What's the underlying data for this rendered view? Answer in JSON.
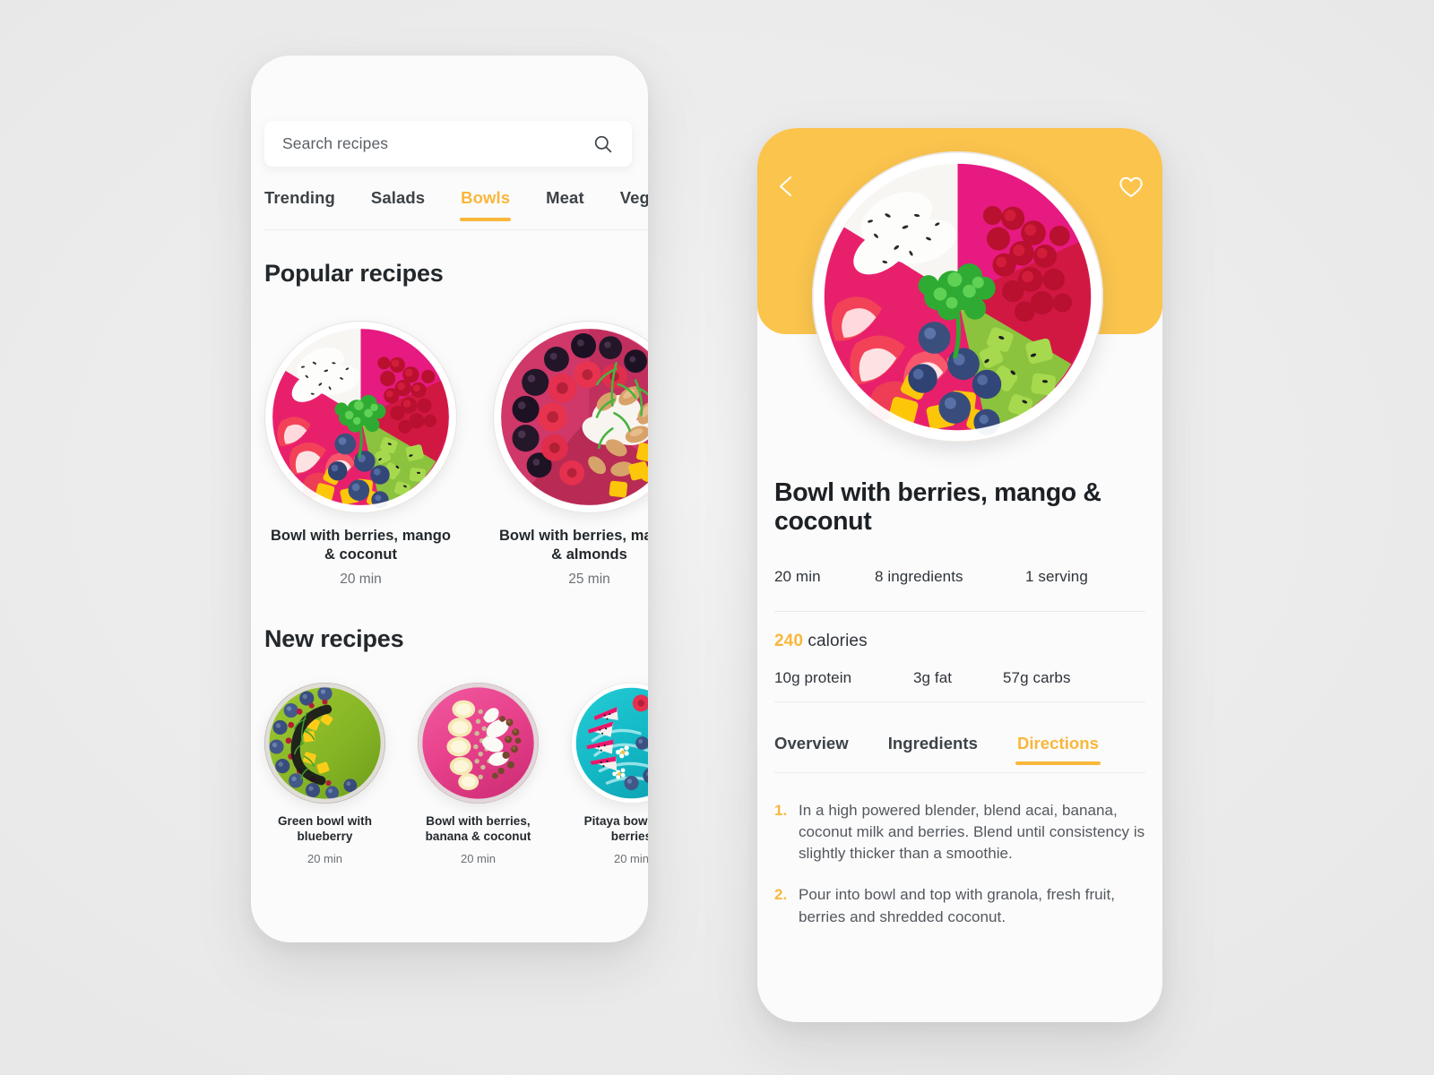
{
  "theme": {
    "accent": "#F9B73C",
    "banner": "#FBC44C",
    "page_bg": "#ECECEC",
    "card_bg": "#FBFBFB",
    "text_dark": "#23282C",
    "text_muted": "#6B7075"
  },
  "home": {
    "search": {
      "placeholder": "Search recipes",
      "value": "",
      "icon": "search-icon"
    },
    "tabs": [
      {
        "label": "Trending",
        "active": false
      },
      {
        "label": "Salads",
        "active": false
      },
      {
        "label": "Bowls",
        "active": true
      },
      {
        "label": "Meat",
        "active": false
      },
      {
        "label": "Veg",
        "active": false
      }
    ],
    "sections": [
      {
        "title": "Popular recipes",
        "recipes": [
          {
            "name": "Bowl with berries, mango & coconut",
            "time": "20 min"
          },
          {
            "name": "Bowl with berries, mango & almonds",
            "time": "25 min"
          }
        ]
      },
      {
        "title": "New recipes",
        "recipes": [
          {
            "name": "Green bowl with blueberry",
            "time": "20 min"
          },
          {
            "name": "Bowl with berries, banana & coconut",
            "time": "20 min"
          },
          {
            "name": "Pitaya bowl with berries",
            "time": "20 min"
          }
        ]
      }
    ]
  },
  "detail": {
    "back_icon": "chevron-left-icon",
    "favorite_icon": "heart-icon",
    "title": "Bowl with berries, mango & coconut",
    "meta": [
      "20 min",
      "8 ingredients",
      "1 serving"
    ],
    "calories": {
      "value": "240",
      "label": " calories"
    },
    "macros": [
      "10g protein",
      "3g fat",
      "57g carbs"
    ],
    "tabs": [
      {
        "label": "Overview",
        "active": false
      },
      {
        "label": "Ingredients",
        "active": false
      },
      {
        "label": "Directions",
        "active": true
      }
    ],
    "directions": [
      {
        "num": "1.",
        "text": "In a high powered blender, blend acai, banana, coconut milk and berries. Blend until consistency is slightly thicker than a smoothie."
      },
      {
        "num": "2.",
        "text": "Pour into bowl and top with granola, fresh fruit, berries and shredded coconut."
      }
    ]
  }
}
